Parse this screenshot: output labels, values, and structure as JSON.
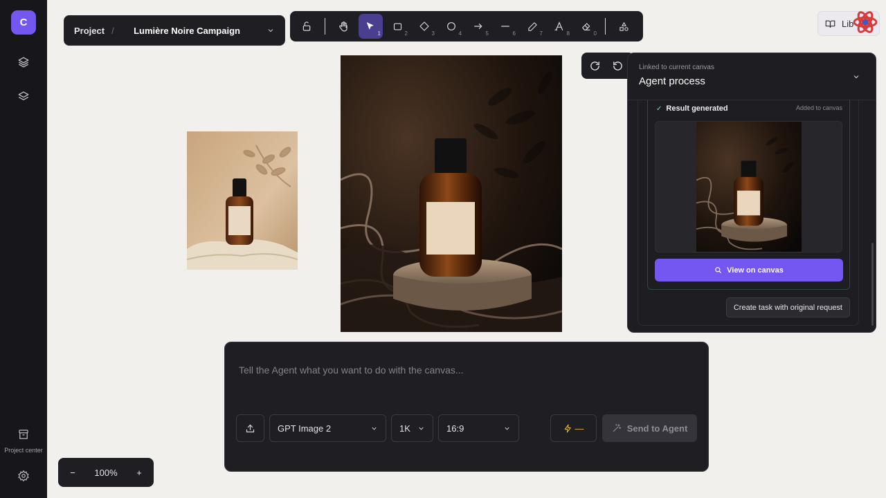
{
  "app": {
    "logo_letter": "C"
  },
  "rail": {
    "project_center_label": "Project center"
  },
  "project": {
    "label": "Project",
    "separator": "/",
    "name": "Lumière Noire Campaign"
  },
  "toolbar": {
    "tools": [
      {
        "icon": "lock-icon",
        "key": ""
      },
      {
        "icon": "hand-icon",
        "key": ""
      },
      {
        "icon": "cursor-icon",
        "key": "1"
      },
      {
        "icon": "rectangle-icon",
        "key": "2"
      },
      {
        "icon": "diamond-icon",
        "key": "3"
      },
      {
        "icon": "ellipse-icon",
        "key": "4"
      },
      {
        "icon": "arrow-icon",
        "key": "5"
      },
      {
        "icon": "line-icon",
        "key": "6"
      },
      {
        "icon": "pencil-icon",
        "key": "7"
      },
      {
        "icon": "text-icon",
        "key": "8"
      },
      {
        "icon": "eraser-icon",
        "key": "0"
      },
      {
        "icon": "shapes-icon",
        "key": ""
      }
    ]
  },
  "library": {
    "label": "Lib"
  },
  "panel": {
    "subtitle": "Linked to current canvas",
    "title": "Agent process",
    "result_title": "Result generated",
    "result_status": "Added to canvas",
    "view_button": "View on canvas",
    "create_button": "Create task with original request"
  },
  "prompt": {
    "placeholder": "Tell the Agent what you want to do with the canvas...",
    "model": "GPT Image 2",
    "resolution": "1K",
    "aspect": "16:9",
    "credits": "—",
    "send_label": "Send to Agent"
  },
  "zoom": {
    "level": "100%",
    "minus": "−",
    "plus": "+"
  },
  "colors": {
    "accent": "#7357f0",
    "panel_bg": "#1d1d22",
    "canvas_bg": "#f2f0ec"
  }
}
